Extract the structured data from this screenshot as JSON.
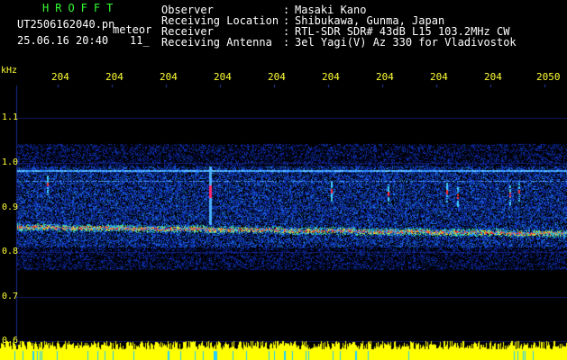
{
  "header": {
    "logo": "HROFFT",
    "filename": "UT2506162040.pn",
    "mode": "meteor",
    "datetime": "25.06.16 20:40",
    "count": "11_",
    "fields": [
      {
        "label": "Observer",
        "sep": ":",
        "value": "Masaki Kano"
      },
      {
        "label": "Receiving Location",
        "sep": ":",
        "value": "Shibukawa, Gunma, Japan"
      },
      {
        "label": "Receiver",
        "sep": ":",
        "value": "RTL-SDR SDR# 43dB L15 103.2MHz CW"
      },
      {
        "label": "Receiving Antenna",
        "sep": ":",
        "value": "3el Yagi(V) Az 330 for Vladivostok"
      }
    ]
  },
  "axis": {
    "unit": "kHz",
    "x_ticks": [
      "204",
      "204",
      "204",
      "204",
      "204",
      "204",
      "204",
      "204",
      "204",
      "2050"
    ],
    "y_ticks": [
      "1.1",
      "1.0",
      "0.9",
      "0.8",
      "0.7",
      "0.6"
    ]
  },
  "colors": {
    "background": "#000000",
    "text": "#ffffff",
    "logo": "#33ff33",
    "ticks": "#ffff33",
    "grid": "#2a3fbf",
    "noise_low": "#0a1a8a",
    "noise_high": "#ff2020",
    "meter": "#ffff00"
  }
}
